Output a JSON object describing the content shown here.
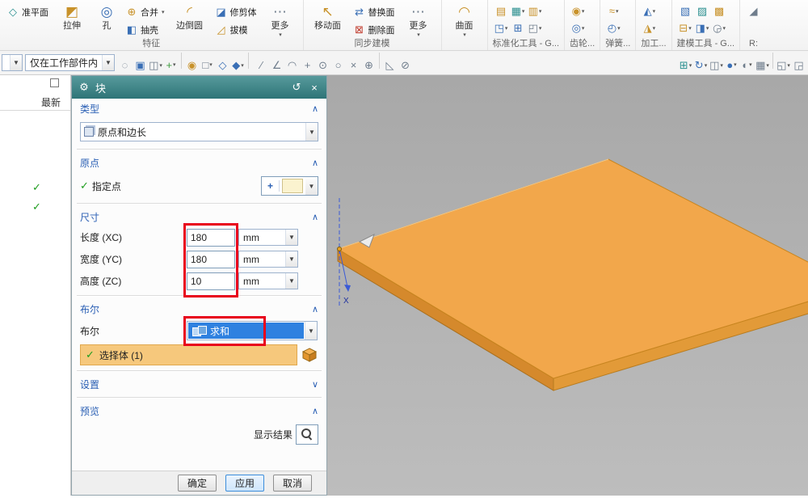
{
  "colors": {
    "dialog_titlebar": "#3f8486",
    "section_header_text": "#2a5fb4",
    "selection_highlight": "#f6c87c",
    "combo_selected_blue": "#2f81e0",
    "annotation_red": "#e8001c",
    "body_orange_top": "#f2a74b",
    "body_orange_side": "#d5892c",
    "check_green": "#1f9d1f",
    "viewport_gray": "#b0b0b0"
  },
  "ribbon": {
    "groups": [
      {
        "label": "特征"
      },
      {
        "label": "同步建模"
      },
      {
        "label": ""
      },
      {
        "label": "标准化工具 - G..."
      },
      {
        "label": "齿轮..."
      },
      {
        "label": "弹簧..."
      },
      {
        "label": "加工..."
      },
      {
        "label": "建模工具 - G..."
      },
      {
        "label": "R:"
      }
    ],
    "feature": {
      "datum_plane": "准平面",
      "extrude": "拉伸",
      "hole": "孔",
      "unite": "合并",
      "shell": "抽壳",
      "edge_blend": "边倒圆",
      "trim_body": "修剪体",
      "draft": "拔模",
      "more": "更多"
    },
    "sync": {
      "move_face": "移动面",
      "replace_face": "替换面",
      "delete_face": "删除面",
      "more": "更多"
    },
    "surface": "曲面",
    "std_icons": [
      {
        "g": "▤",
        "n": "standard-parts-icon",
        "cls": "c-gold"
      },
      {
        "g": "◳",
        "n": "fastener-assembly-icon",
        "cls": "c-blue",
        "dd": true
      },
      {
        "g": "▦",
        "n": "part-family-icon",
        "cls": "c-teal",
        "dd": true
      },
      {
        "g": "⊞",
        "n": "reuse-library-icon",
        "cls": "c-blue"
      },
      {
        "g": "▥",
        "n": "hole-series-icon",
        "cls": "c-gold",
        "dd": true
      },
      {
        "g": "◰",
        "n": "standard-tools-more-icon",
        "cls": "c-gray",
        "dd": true
      }
    ],
    "gear_icons": [
      {
        "g": "◉",
        "n": "cylinder-gear-icon",
        "cls": "c-gold",
        "dd": true
      },
      {
        "g": "◎",
        "n": "bevel-gear-icon",
        "cls": "c-blue",
        "dd": true
      }
    ],
    "spring_icons": [
      {
        "g": "≈",
        "n": "spring-design-icon",
        "cls": "c-gold",
        "dd": true
      },
      {
        "g": "◴",
        "n": "spring-tools-icon",
        "cls": "c-blue",
        "dd": true
      }
    ],
    "mach_icons": [
      {
        "g": "◭",
        "n": "mold-tools-icon",
        "cls": "c-blue",
        "dd": true
      },
      {
        "g": "◮",
        "n": "electrode-tools-icon",
        "cls": "c-gold",
        "dd": true
      }
    ],
    "model_icons": [
      {
        "g": "▧",
        "n": "expression-icon",
        "cls": "c-blue"
      },
      {
        "g": "⊟",
        "n": "suppress-feature-icon",
        "cls": "c-gold",
        "dd": true
      },
      {
        "g": "▨",
        "n": "part-cleanup-icon",
        "cls": "c-teal"
      },
      {
        "g": "◨",
        "n": "measure-icon",
        "cls": "c-blue",
        "dd": true
      },
      {
        "g": "▩",
        "n": "layer-settings-icon",
        "cls": "c-gold"
      },
      {
        "g": "◶",
        "n": "wave-linker-icon",
        "cls": "c-gray",
        "dd": true
      }
    ],
    "extra_icons": [
      {
        "g": "◢",
        "n": "truncated-tool-icon",
        "cls": "c-gray"
      }
    ]
  },
  "selectbar": {
    "filter_value": "",
    "scope_value": "仅在工作部件内",
    "icons_left": [
      {
        "g": "◌",
        "n": "no-selection-filter-icon",
        "cls": "c-gray"
      },
      {
        "g": "▣",
        "n": "general-object-filter-icon",
        "cls": "c-blue"
      },
      {
        "g": "◫",
        "n": "face-rule-icon",
        "cls": "c-gray",
        "dd": true
      },
      {
        "g": "+",
        "n": "snap-point-toggle-icon",
        "cls": "c-green",
        "dd": true
      },
      {
        "sep": true
      },
      {
        "g": "◉",
        "n": "select-point-icon",
        "cls": "c-gold"
      },
      {
        "g": "□",
        "n": "rectangle-select-icon",
        "cls": "c-gray",
        "dd": true
      },
      {
        "g": "◇",
        "n": "region-select-icon",
        "cls": "c-blue"
      },
      {
        "g": "◆",
        "n": "polygon-select-icon",
        "cls": "c-blue",
        "dd": true
      },
      {
        "sep": true
      }
    ],
    "icons_mid": [
      {
        "g": "∕",
        "n": "snap-endpoint-icon",
        "cls": "c-gray"
      },
      {
        "g": "∠",
        "n": "snap-midpoint-icon",
        "cls": "c-gray"
      },
      {
        "g": "◠",
        "n": "snap-arc-icon",
        "cls": "c-gray"
      },
      {
        "g": "+",
        "n": "snap-intersection-icon",
        "cls": "c-gray"
      },
      {
        "g": "⊙",
        "n": "snap-center-icon",
        "cls": "c-gray"
      },
      {
        "g": "○",
        "n": "snap-quadrant-icon",
        "cls": "c-gray"
      },
      {
        "g": "×",
        "n": "snap-existing-point-icon",
        "cls": "c-gray"
      },
      {
        "g": "⊕",
        "n": "snap-point-on-curve-icon",
        "cls": "c-gray"
      },
      {
        "sep": true
      },
      {
        "g": "◺",
        "n": "snap-tangent-icon",
        "cls": "c-gray"
      },
      {
        "g": "⊘",
        "n": "snap-disable-icon",
        "cls": "c-gray"
      }
    ],
    "icons_right": [
      {
        "g": "⊞",
        "n": "datum-grid-icon",
        "cls": "c-teal",
        "dd": true
      },
      {
        "g": "↻",
        "n": "orient-view-icon",
        "cls": "c-blue",
        "dd": true
      },
      {
        "g": "◫",
        "n": "view-section-icon",
        "cls": "c-gray",
        "dd": true
      },
      {
        "g": "●",
        "n": "shaded-display-icon",
        "cls": "c-blue",
        "dd": true
      },
      {
        "g": "◐",
        "n": "rendering-style-icon",
        "cls": "c-gray",
        "dd": true
      },
      {
        "g": "▦",
        "n": "wireframe-display-icon",
        "cls": "c-gray",
        "dd": true
      },
      {
        "sep": true
      },
      {
        "g": "◱",
        "n": "show-hide-icon",
        "cls": "c-gray",
        "dd": true
      },
      {
        "g": "◲",
        "n": "immersive-view-icon",
        "cls": "c-gray"
      }
    ]
  },
  "navigator": {
    "header": "最新",
    "checks": [
      "✓",
      "✓"
    ]
  },
  "dialog": {
    "title": "块",
    "sections": {
      "type": {
        "label": "类型",
        "value": "原点和边长"
      },
      "origin": {
        "label": "原点",
        "point_check": "✓",
        "point_label": "指定点"
      },
      "dimensions": {
        "label": "尺寸",
        "rows": [
          {
            "label": "长度 (XC)",
            "value": "180",
            "unit": "mm"
          },
          {
            "label": "宽度 (YC)",
            "value": "180",
            "unit": "mm"
          },
          {
            "label": "高度 (ZC)",
            "value": "10",
            "unit": "mm"
          }
        ]
      },
      "boolean": {
        "label": "布尔",
        "row_label": "布尔",
        "value": "求和",
        "body_check": "✓",
        "body_label": "选择体 (1)"
      },
      "settings": {
        "label": "设置"
      },
      "preview": {
        "label": "预览",
        "show_result": "显示结果"
      }
    },
    "buttons": {
      "ok": "确定",
      "apply": "应用",
      "cancel": "取消"
    }
  },
  "viewport": {
    "axis_x_label": "X"
  }
}
